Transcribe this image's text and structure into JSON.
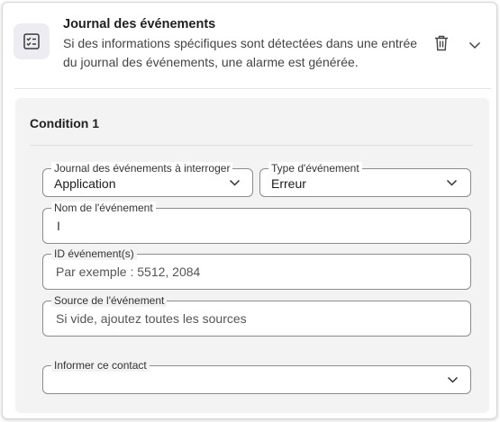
{
  "header": {
    "title": "Journal des événements",
    "description": "Si des informations spécifiques sont détectées dans une entrée du journal des événements, une alarme est générée.",
    "icon": "checklist-icon",
    "delete_icon": "trash-icon",
    "expand_icon": "chevron-down-icon"
  },
  "condition": {
    "title": "Condition 1",
    "fields": {
      "journal": {
        "label": "Journal des événements à interroger",
        "value": "Application"
      },
      "type": {
        "label": "Type d'événement",
        "value": "Erreur"
      },
      "name": {
        "label": "Nom de l'événement",
        "value": "I"
      },
      "id": {
        "label": "ID événement(s)",
        "placeholder": "Par exemple : 5512, 2084"
      },
      "source": {
        "label": "Source de l'événement",
        "placeholder": "Si vide, ajoutez toutes les sources"
      },
      "contact": {
        "label": "Informer ce contact",
        "value": ""
      }
    }
  },
  "colors": {
    "panel": "#f3f3f3",
    "icon_tile": "#ececf2",
    "border": "#8c8c8c"
  }
}
